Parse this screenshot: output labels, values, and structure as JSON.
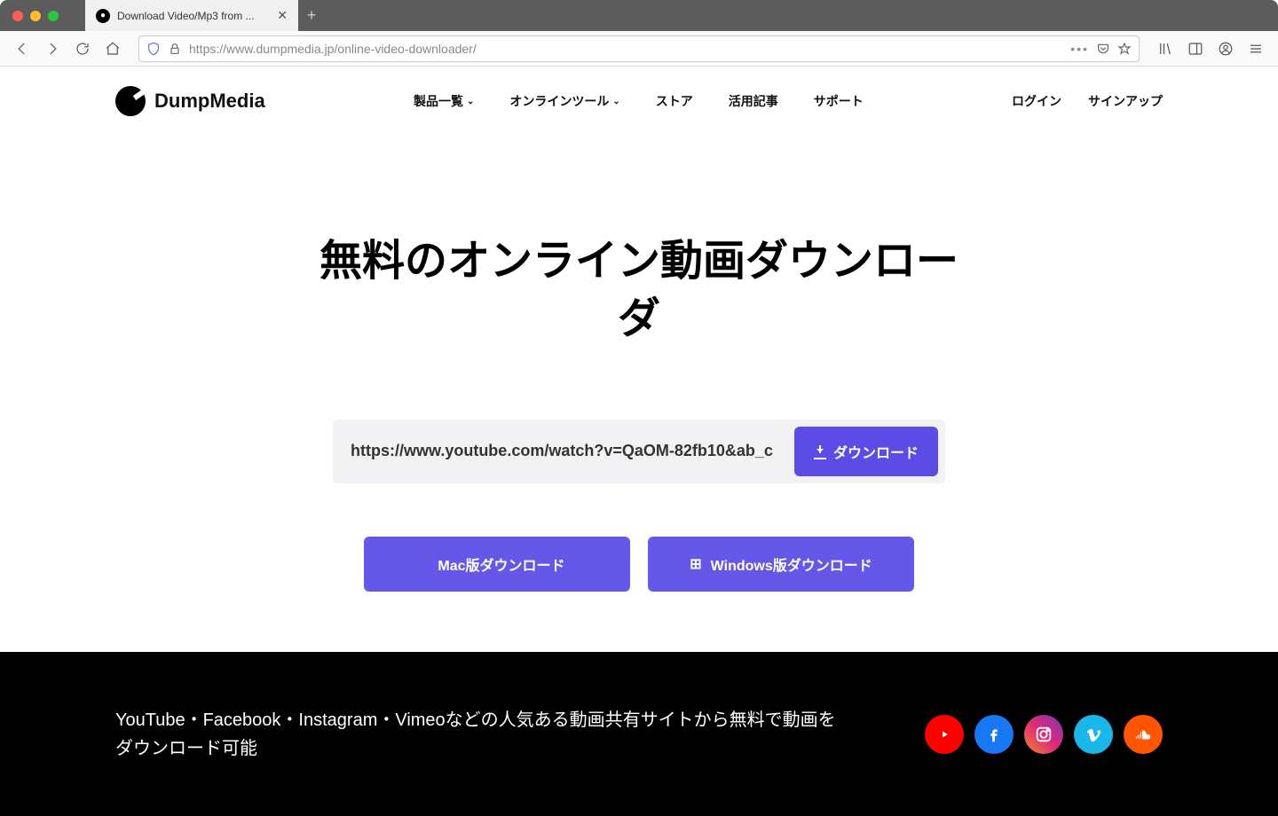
{
  "browser": {
    "tab_title": "Download Video/Mp3 from ...",
    "url": "https://www.dumpmedia.jp/online-video-downloader/"
  },
  "site": {
    "logo_text": "DumpMedia",
    "nav": {
      "products": "製品一覧",
      "tools": "オンラインツール",
      "store": "ストア",
      "articles": "活用記事",
      "support": "サポート"
    },
    "auth": {
      "login": "ログイン",
      "signup": "サインアップ"
    }
  },
  "hero": {
    "title": "無料のオンライン動画ダウンローダ",
    "input_value": "https://www.youtube.com/watch?v=QaOM-82fb10&ab_c",
    "download_label": "ダウンロード",
    "mac_button": "Mac版ダウンロード",
    "windows_button": "Windows版ダウンロード"
  },
  "footer": {
    "text": "YouTube・Facebook・Instagram・Vimeoなどの人気ある動画共有サイトから無料で動画をダウンロード可能",
    "socials": [
      "youtube",
      "facebook",
      "instagram",
      "vimeo",
      "soundcloud"
    ]
  }
}
